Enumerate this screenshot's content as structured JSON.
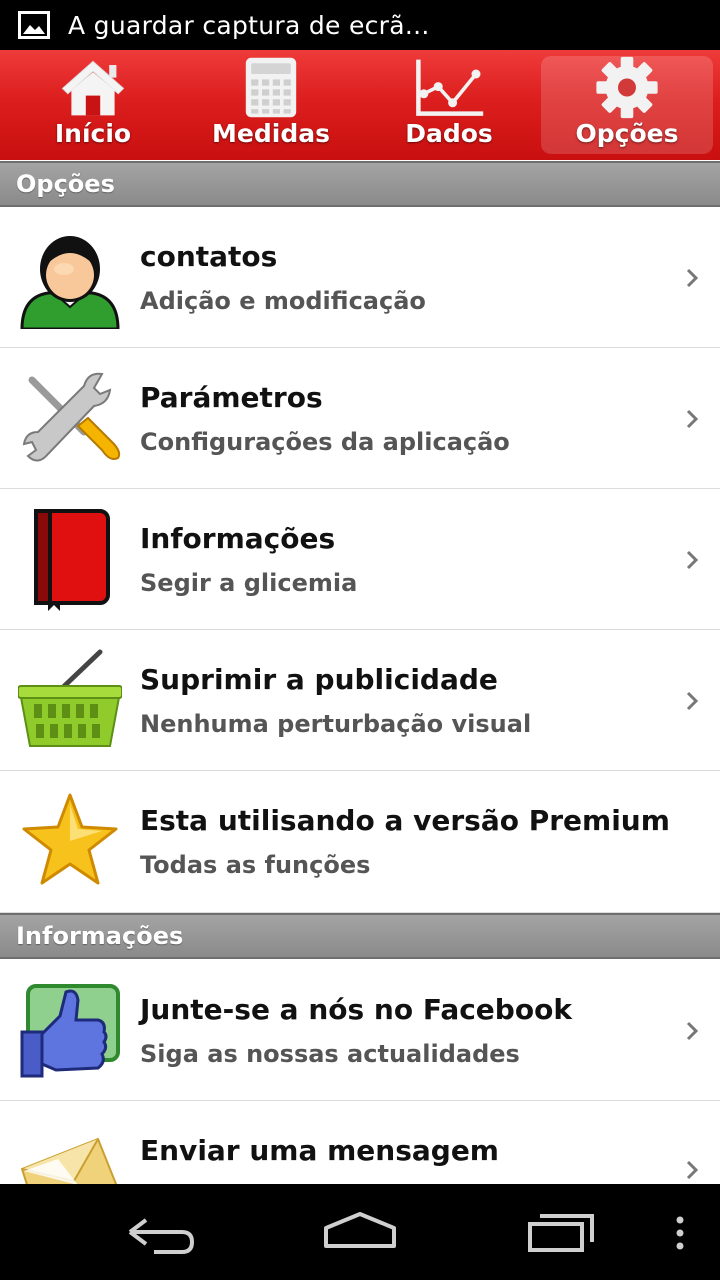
{
  "status_bar": {
    "notification": "A guardar captura de ecrã..."
  },
  "tabs": [
    {
      "label": "Início",
      "icon": "house-icon"
    },
    {
      "label": "Medidas",
      "icon": "calculator-icon"
    },
    {
      "label": "Dados",
      "icon": "line-chart-icon"
    },
    {
      "label": "Opções",
      "icon": "gear-icon",
      "active": true
    }
  ],
  "sections": {
    "options": "Opções",
    "info": "Informações"
  },
  "items": [
    {
      "title": "contatos",
      "subtitle": "Adição e modificação",
      "icon": "person-icon"
    },
    {
      "title": "Parámetros",
      "subtitle": "Configurações da aplicação",
      "icon": "tools-icon"
    },
    {
      "title": "Informações",
      "subtitle": "Segir a glicemia",
      "icon": "book-icon"
    },
    {
      "title": "Suprimir a publicidade",
      "subtitle": "Nenhuma perturbação visual",
      "icon": "basket-icon"
    },
    {
      "title": "Esta utilisando a versão Premium",
      "subtitle": "Todas as funções",
      "icon": "star-icon"
    },
    {
      "title": "Junte-se a nós no Facebook",
      "subtitle": "Siga as nossas actualidades",
      "icon": "thumbs-up-icon"
    },
    {
      "title": "Enviar uma mensagem",
      "subtitle": "",
      "icon": "envelope-icon"
    }
  ],
  "colors": {
    "tab_bar": "#dc1e1e",
    "section_header": "#999999"
  }
}
